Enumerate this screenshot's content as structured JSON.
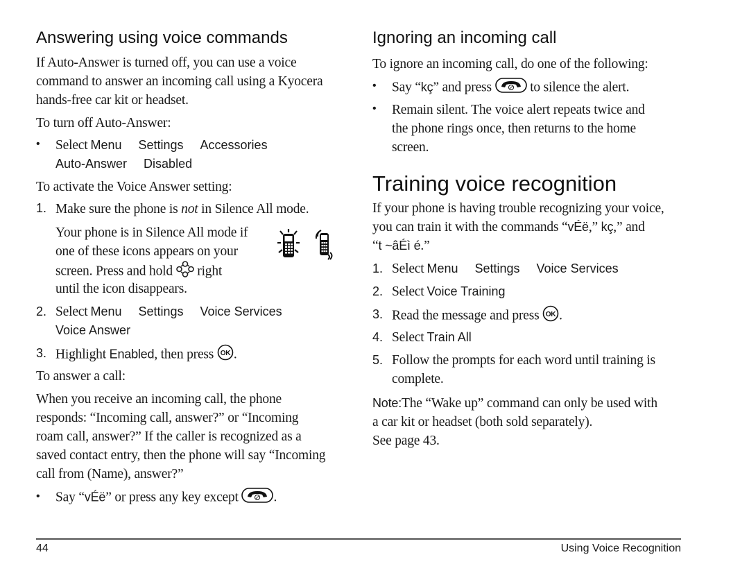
{
  "left": {
    "section_title": "Answering using voice commands",
    "intro": [
      "If Auto-Answer is turned off, you can use a voice",
      "command to answer an incoming call using a Kyocera",
      "hands-free car kit or headset."
    ],
    "turn_off_label": "To turn off Auto-Answer:",
    "turn_off_step": {
      "prefix": "Select",
      "path": [
        "Menu",
        "Settings",
        "Accessories",
        "Auto-Answer",
        "Disabled"
      ]
    },
    "activate_label": "To activate the Voice Answer setting:",
    "step1": {
      "number": "1.",
      "text_before": "Make sure the phone is ",
      "emphasis": "not",
      "text_after": " in Silence All mode.",
      "detail": [
        "Your phone is in Silence All mode if",
        "one of these icons appears on your",
        "screen. Press and hold",
        "right",
        "until the icon disappears."
      ]
    },
    "step2": {
      "number": "2.",
      "prefix": "Select",
      "path": [
        "Menu",
        "Settings",
        "Voice Services",
        "Voice Answer"
      ]
    },
    "step3": {
      "number": "3.",
      "text_before": "Highlight ",
      "ui_term": "Enabled",
      "text_after": ", then press",
      "end": "."
    },
    "answer_label": "To answer a call:",
    "answer_paragraph": [
      "When you receive an incoming call, the phone",
      "responds: “Incoming call, answer?” or “Incoming",
      "roam call, answer?” If the caller is recognized as a",
      "saved contact entry, then the phone will say “Incoming",
      "call from (Name), answer?”"
    ],
    "answer_bullet": {
      "text_before": "Say “",
      "command": "vÉë",
      "text_after": "” or press any key except",
      "end": "."
    }
  },
  "right": {
    "section_title": "Ignoring an incoming call",
    "intro": "To ignore an incoming call, do one of the following:",
    "bullets": [
      {
        "text_before": "Say “",
        "command": "kç",
        "text_after": "” and press",
        "text_end": "to silence the alert."
      },
      {
        "lines": [
          "Remain silent. The voice alert repeats twice and",
          "the phone rings once, then returns to the home",
          "screen."
        ]
      }
    ],
    "training_title": "Training voice recognition",
    "training_intro": {
      "line1": "If your phone is having trouble recognizing your voice,",
      "line2_before": "you can train it with the commands “",
      "cmd1": "vÉë",
      "line2_mid": ",” ",
      "cmd2": "kç",
      "line2_after": ",” and",
      "line3_before": "“",
      "cmd3": "t ~âÉì é",
      "line3_after": ".”"
    },
    "steps": [
      {
        "number": "1.",
        "prefix": "Select",
        "path": [
          "Menu",
          "Settings",
          "Voice Services"
        ]
      },
      {
        "number": "2.",
        "prefix": "Select",
        "ui_term": "Voice Training"
      },
      {
        "number": "3.",
        "text": "Read the message and press",
        "end": "."
      },
      {
        "number": "4.",
        "prefix": "Select",
        "ui_term": "Train All"
      },
      {
        "number": "5.",
        "lines": [
          "Follow the prompts for each word until training is",
          "complete."
        ]
      }
    ],
    "note": {
      "label": "Note:",
      "lines": [
        "The “Wake up” command can only be used with",
        "a car kit or headset (both sold separately)."
      ],
      "see_page": "See page 43."
    }
  },
  "footer": {
    "page_number": "44",
    "chapter": "Using Voice Recognition"
  },
  "icons": {
    "silence_all_icons": [
      "phone-silence-all-icon",
      "phone-vibrate-icon"
    ],
    "navigation_key": "nav-key-icon",
    "ok_key": "ok-key-icon",
    "end_key": "end-call-key-icon"
  }
}
